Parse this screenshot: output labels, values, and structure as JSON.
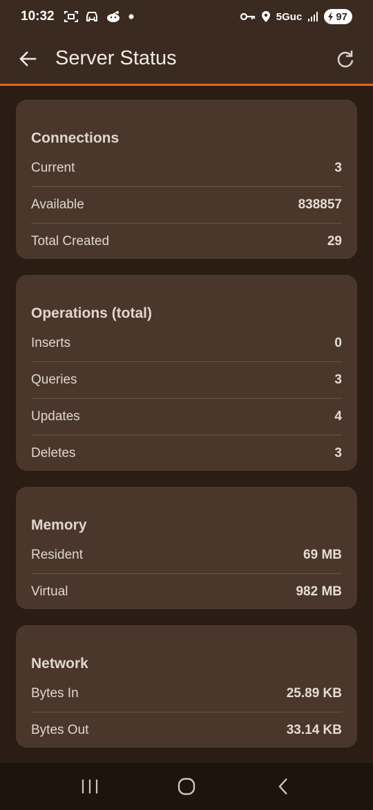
{
  "status_bar": {
    "time": "10:32",
    "network": "5Guc",
    "battery": "97"
  },
  "app_bar": {
    "title": "Server Status"
  },
  "sections": [
    {
      "title": "Connections",
      "rows": [
        {
          "label": "Current",
          "value": "3"
        },
        {
          "label": "Available",
          "value": "838857"
        },
        {
          "label": "Total Created",
          "value": "29"
        }
      ]
    },
    {
      "title": "Operations (total)",
      "rows": [
        {
          "label": "Inserts",
          "value": "0"
        },
        {
          "label": "Queries",
          "value": "3"
        },
        {
          "label": "Updates",
          "value": "4"
        },
        {
          "label": "Deletes",
          "value": "3"
        }
      ]
    },
    {
      "title": "Memory",
      "rows": [
        {
          "label": "Resident",
          "value": "69 MB"
        },
        {
          "label": "Virtual",
          "value": "982 MB"
        }
      ]
    },
    {
      "title": "Network",
      "rows": [
        {
          "label": "Bytes In",
          "value": "25.89 KB"
        },
        {
          "label": "Bytes Out",
          "value": "33.14 KB"
        }
      ]
    }
  ],
  "colors": {
    "accent": "#e8622a",
    "app_bar": "#3a2a20",
    "background": "#2b1d14",
    "card": "#4a362a"
  }
}
